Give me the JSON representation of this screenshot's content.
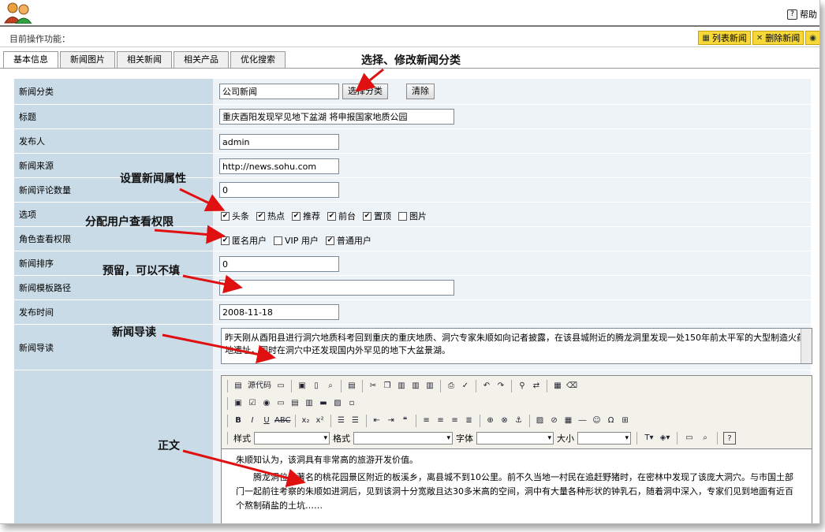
{
  "header": {
    "help_label": "帮助"
  },
  "op_bar": {
    "label": "目前操作功能：",
    "buttons": [
      "列表新闻",
      "删除新闻"
    ]
  },
  "tabs": [
    "基本信息",
    "新闻图片",
    "相关新闻",
    "相关产品",
    "优化搜索"
  ],
  "form": {
    "category": {
      "label": "新闻分类",
      "value": "公司新闻",
      "select_btn": "选择分类",
      "clear_btn": "清除"
    },
    "title": {
      "label": "标题",
      "value": "重庆酉阳发现罕见地下盆湖 将申报国家地质公园"
    },
    "author": {
      "label": "发布人",
      "value": "admin"
    },
    "source": {
      "label": "新闻来源",
      "value": "http://news.sohu.com"
    },
    "comments": {
      "label": "新闻评论数量",
      "value": "0"
    },
    "options": {
      "label": "选项",
      "items": [
        {
          "text": "头条",
          "checked": true
        },
        {
          "text": "热点",
          "checked": true
        },
        {
          "text": "推荐",
          "checked": true
        },
        {
          "text": "前台",
          "checked": true
        },
        {
          "text": "置顶",
          "checked": true
        },
        {
          "text": "图片",
          "checked": false
        }
      ]
    },
    "roles": {
      "label": "角色查看权限",
      "items": [
        {
          "text": "匿名用户",
          "checked": true
        },
        {
          "text": "VIP 用户",
          "checked": false
        },
        {
          "text": "普通用户",
          "checked": true
        }
      ]
    },
    "sort": {
      "label": "新闻排序",
      "value": "0"
    },
    "template": {
      "label": "新闻模板路径",
      "value": ""
    },
    "pubdate": {
      "label": "发布时间",
      "value": "2008-11-18"
    },
    "summary": {
      "label": "新闻导读",
      "value": "昨天刚从酉阳县进行洞穴地质科考回到重庆的重庆地质、洞穴专家朱顺如向记者披露，在该县城附近的腾龙洞里发现一处150年前太平军的大型制造火药地遗址，同时在洞穴中还发现国内外罕见的地下大盆景湖。"
    }
  },
  "editor": {
    "source_label": "源代码",
    "style_label": "样式",
    "format_label": "格式",
    "font_label": "字体",
    "size_label": "大小",
    "content": [
      "朱顺知认为，该洞具有非常高的旅游开发价值。",
      "腾龙洞位于著名的桃花园景区附近的板溪乡，离县城不到10公里。前不久当地一村民在追赶野猪时，在密林中发现了该庞大洞穴。与市国土部门一起前往考察的朱顺如进洞后，见到该洞十分宽敞且达30多米高的空间，洞中有大量各种形状的钟乳石，随着洞中深入，专家们见到地面有近百个熬制硝盐的土坑……"
    ]
  },
  "annotations": {
    "category": "选择、修改新闻分类",
    "attrs": "设置新闻属性",
    "perms": "分配用户查看权限",
    "reserved": "预留，可以不填",
    "summary": "新闻导读",
    "body": "正文"
  },
  "colors": {
    "label_bg": "#c8dbe7",
    "value_bg": "#eef3f8",
    "op_btn": "#f8d838"
  }
}
